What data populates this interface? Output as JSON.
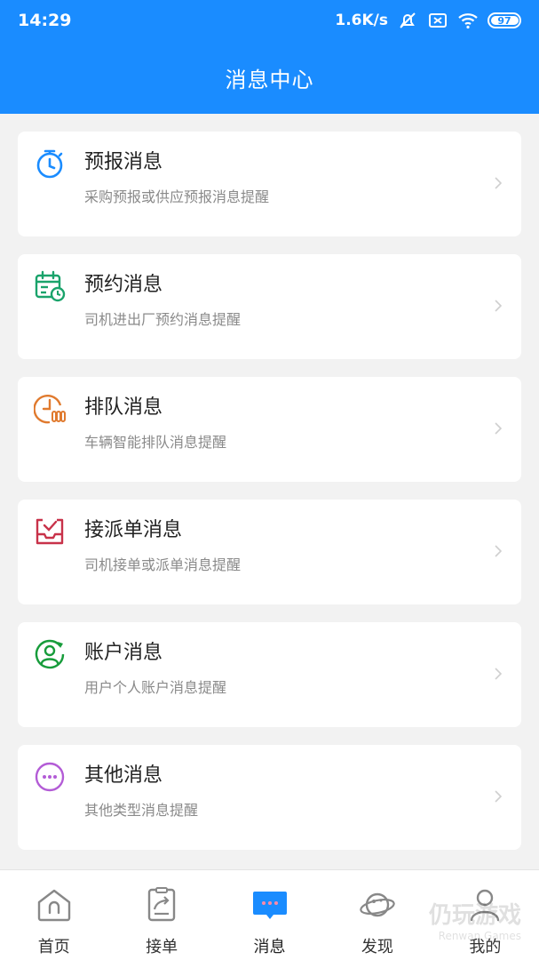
{
  "status_bar": {
    "time": "14:29",
    "speed": "1.6K/s",
    "battery": "97",
    "icons": [
      "mute-bell-icon",
      "sim-x-icon",
      "wifi-icon",
      "battery-icon"
    ]
  },
  "header": {
    "title": "消息中心"
  },
  "colors": {
    "primary": "#1a8cff",
    "forecast": "#1a8cff",
    "reservation": "#1aa36b",
    "queue": "#e07a2e",
    "dispatch": "#c8324a",
    "account": "#179c3b",
    "other": "#b35cd6"
  },
  "messages": [
    {
      "title": "预报消息",
      "desc": "采购预报或供应预报消息提醒",
      "icon": "stopwatch-icon"
    },
    {
      "title": "预约消息",
      "desc": "司机进出厂预约消息提醒",
      "icon": "calendar-clock-icon"
    },
    {
      "title": "排队消息",
      "desc": "车辆智能排队消息提醒",
      "icon": "queue-clock-icon"
    },
    {
      "title": "接派单消息",
      "desc": "司机接单或派单消息提醒",
      "icon": "inbox-check-icon"
    },
    {
      "title": "账户消息",
      "desc": "用户个人账户消息提醒",
      "icon": "user-refresh-icon"
    },
    {
      "title": "其他消息",
      "desc": "其他类型消息提醒",
      "icon": "more-dots-icon"
    }
  ],
  "tabs": [
    {
      "label": "首页",
      "icon": "home-icon"
    },
    {
      "label": "接单",
      "icon": "order-icon"
    },
    {
      "label": "消息",
      "icon": "message-icon",
      "active": true
    },
    {
      "label": "发现",
      "icon": "planet-icon"
    },
    {
      "label": "我的",
      "icon": "user-icon"
    }
  ],
  "watermark": {
    "main": "仍玩游戏",
    "sub": "Renwan Games"
  }
}
